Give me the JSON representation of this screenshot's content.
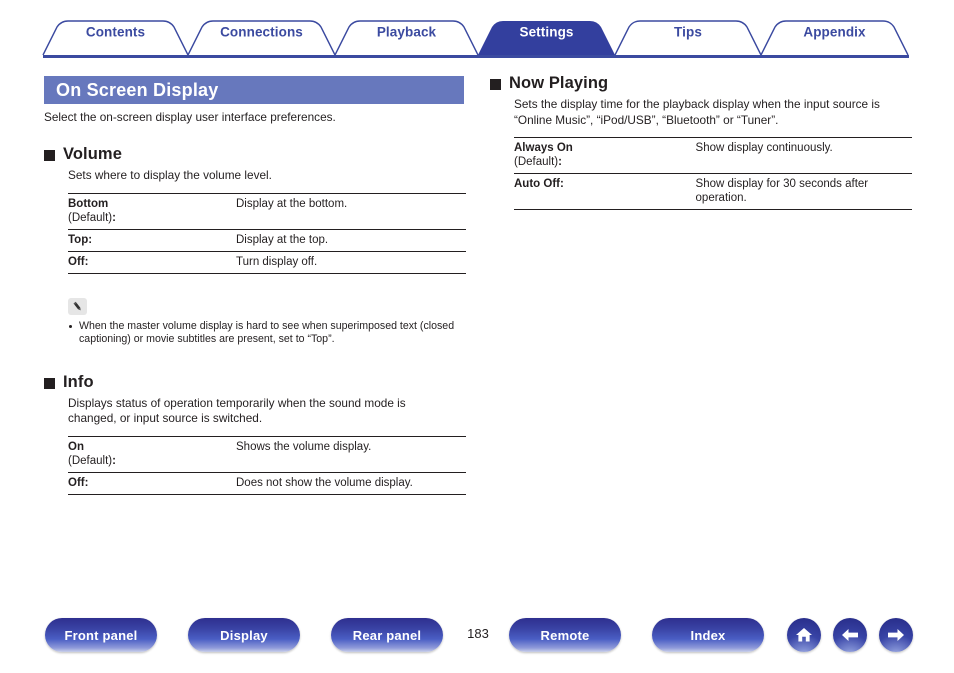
{
  "colors": {
    "tab_border": "#3b4aa0",
    "tab_active_bg": "#333f9e",
    "tab_text": "#3b4aa0",
    "title_bar_bg": "#6778bd",
    "rule": "#3b4aa0",
    "body_text": "#231f20",
    "button_blue_dark": "#2e2f8f",
    "button_blue_light": "#c9cfe9"
  },
  "tabs": [
    {
      "label": "Contents",
      "active": false,
      "icon": "tab-shape"
    },
    {
      "label": "Connections",
      "active": false,
      "icon": "tab-shape"
    },
    {
      "label": "Playback",
      "active": false,
      "icon": "tab-shape"
    },
    {
      "label": "Settings",
      "active": true,
      "icon": "tab-shape"
    },
    {
      "label": "Tips",
      "active": false,
      "icon": "tab-shape"
    },
    {
      "label": "Appendix",
      "active": false,
      "icon": "tab-shape"
    }
  ],
  "page": {
    "title": "On Screen Display",
    "intro": "Select the on-screen display user interface preferences.",
    "number": "183"
  },
  "sections": {
    "volume": {
      "heading": "Volume",
      "description": "Sets where to display the volume level.",
      "rows": [
        {
          "name": "Bottom",
          "default_label": "(Default)",
          "colon": ":",
          "value": "Display at the bottom."
        },
        {
          "name": "Top:",
          "default_label": "",
          "colon": "",
          "value": "Display at the top."
        },
        {
          "name": "Off:",
          "default_label": "",
          "colon": "",
          "value": "Turn display off."
        }
      ]
    },
    "info": {
      "heading": "Info",
      "description": "Displays status of operation temporarily when the sound mode is changed, or input source is switched.",
      "rows": [
        {
          "name": "On",
          "default_label": "(Default)",
          "colon": ":",
          "value": "Shows the volume display."
        },
        {
          "name": "Off:",
          "default_label": "",
          "colon": "",
          "value": "Does not show the volume display."
        }
      ]
    },
    "now_playing": {
      "heading": "Now Playing",
      "description": "Sets the display time for the playback display when the input source is “Online Music”, “iPod/USB”, “Bluetooth” or “Tuner”.",
      "rows": [
        {
          "name": "Always On",
          "default_label": "(Default)",
          "colon": ":",
          "value": "Show display continuously."
        },
        {
          "name": "Auto Off:",
          "default_label": "",
          "colon": "",
          "value": "Show display for 30 seconds after operation."
        }
      ]
    }
  },
  "note": {
    "icon": "pencil-icon",
    "items": [
      "When the master volume display is hard to see when superimposed text (closed captioning) or movie subtitles are present, set to “Top”."
    ]
  },
  "footer": {
    "buttons": [
      {
        "label": "Front panel",
        "icon": "pill-button"
      },
      {
        "label": "Display",
        "icon": "pill-button"
      },
      {
        "label": "Rear panel",
        "icon": "pill-button"
      },
      {
        "label": "Remote",
        "icon": "pill-button"
      },
      {
        "label": "Index",
        "icon": "pill-button"
      }
    ],
    "nav_icons": [
      {
        "name": "home-icon"
      },
      {
        "name": "arrow-left-icon"
      },
      {
        "name": "arrow-right-icon"
      }
    ]
  }
}
